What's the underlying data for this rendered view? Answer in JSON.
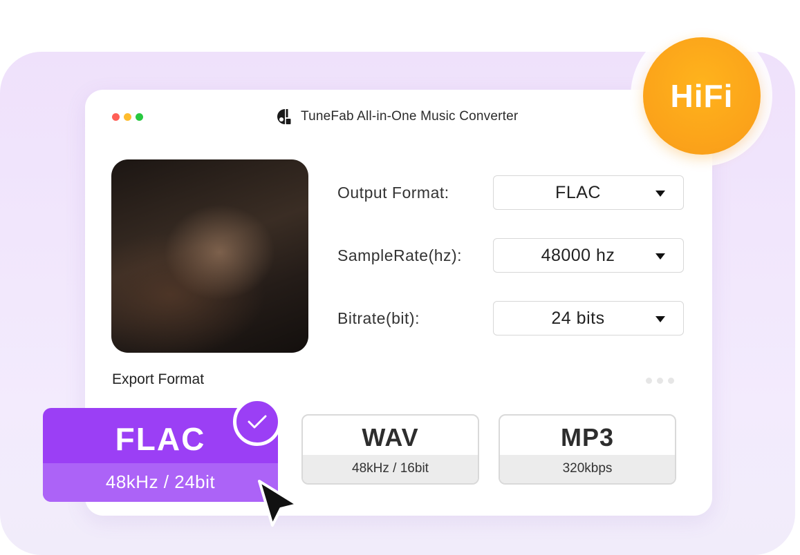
{
  "window": {
    "title": "TuneFab All-in-One Music Converter",
    "traffic_lights": [
      "#ff5f57",
      "#febc2e",
      "#28c840"
    ]
  },
  "badge": {
    "text": "HiFi",
    "color": "#fba21a"
  },
  "settings": [
    {
      "label": "Output Format:",
      "value": "FLAC"
    },
    {
      "label": "SampleRate(hz):",
      "value": "48000 hz"
    },
    {
      "label": "Bitrate(bit):",
      "value": "24 bits"
    }
  ],
  "export": {
    "label": "Export Format",
    "formats": [
      {
        "name": "FLAC",
        "spec": "48kHz / 24bit",
        "selected": true
      },
      {
        "name": "WAV",
        "spec": "48kHz / 16bit",
        "selected": false
      },
      {
        "name": "MP3",
        "spec": "320kbps",
        "selected": false
      }
    ]
  },
  "colors": {
    "accent": "#9b3ff5",
    "accent_light": "#ac63f7"
  },
  "icons": [
    "app-logo-icon",
    "checkmark-icon",
    "cursor-arrow-icon",
    "more-dots-icon",
    "dropdown-caret-icon"
  ]
}
